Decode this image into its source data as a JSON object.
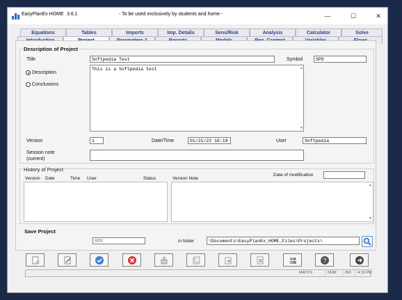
{
  "titlebar": {
    "app_name": "EasyPlanEx HOME",
    "version": "3.6.1",
    "note": "- To be used exclusively by students and home -",
    "minimize": "—",
    "maximize": "☐",
    "close": "✕"
  },
  "tabs": {
    "row1": [
      "Equations",
      "Tables",
      "Imports",
      "Imp. Details",
      "Sens/Risk",
      "Analysis",
      "Calculator",
      "Solve"
    ],
    "row2": [
      "Introduction",
      "Project",
      "Parameters-1",
      "Reports",
      "Models",
      "Rep. Content",
      "Variables",
      "Flows"
    ],
    "active": "Project",
    "hint": "?"
  },
  "description": {
    "legend": "Description of Project",
    "title_label": "Title",
    "title_value": "Softpedia Test",
    "symbol_label": "Symbol",
    "symbol_value": "SPD",
    "radio_description": "Description",
    "radio_conclusions": "Conclusions",
    "selected_radio": "Description",
    "description_text": "This is a Softpedia test",
    "version_label": "Version",
    "version_value": "1",
    "datetime_label": "Date/Time",
    "datetime_value": "01/21/22  16:18",
    "user_label": "User",
    "user_value": "Softpedia",
    "session_label_1": "Session note",
    "session_label_2": "(current)",
    "session_value": ""
  },
  "history": {
    "legend": "History of Project",
    "columns": [
      "Version",
      "Date",
      "Time",
      "User",
      "Status",
      "Version Note"
    ],
    "date_modification_label": "Date of modification",
    "date_modification_value": ""
  },
  "save": {
    "legend": "Save Project",
    "symbol_value": "SPD",
    "folder_label": "in  folder",
    "folder_value": "\\Documents\\EasyPlanEx_HOME_Files\\Projects\\"
  },
  "toolbar": {
    "icons": [
      "new-document-icon",
      "edit-icon",
      "confirm-icon",
      "cancel-icon",
      "export-icon",
      "open-icon",
      "import-icon",
      "delete-icon",
      "users-icon",
      "help-icon",
      "exit-icon"
    ],
    "colors": {
      "confirm": "#3b7fd1",
      "cancel": "#d63a3a",
      "help": "#555555",
      "exit": "#444444"
    }
  },
  "statusbar": {
    "mayus": "MAYÚS",
    "num": "NÚM",
    "ins": "INS",
    "time": "4:19 PM"
  }
}
